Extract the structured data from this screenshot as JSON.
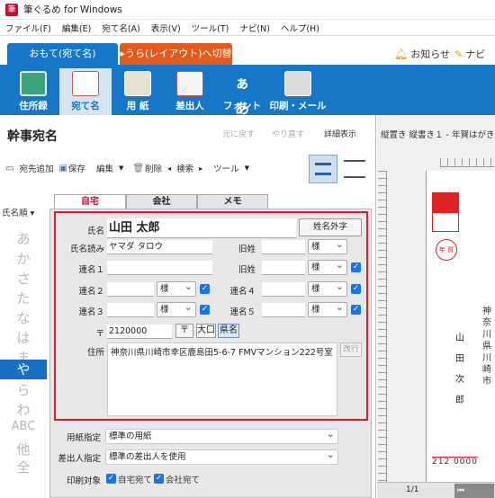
{
  "titlebar": {
    "title": "筆ぐるめ for Windows"
  },
  "menu": [
    "ファイル(F)",
    "編集(E)",
    "宛て名(A)",
    "表示(V)",
    "ツール(T)",
    "ナビ(N)",
    "ヘルプ(H)"
  ],
  "tabs": {
    "omote": "おもて(宛て名)",
    "ura": "▸うら(レイアウト)へ切替",
    "oshirase": "お知らせ",
    "navi": "ナビ"
  },
  "ribbon": [
    "住所録",
    "宛て名",
    "用 紙",
    "差出人",
    "フォント",
    "印刷・メール"
  ],
  "panel": {
    "title": "幹事宛名",
    "undo": "元に戻す",
    "redo": "やり直す",
    "detail": "詳細表示"
  },
  "toolbar": {
    "add": "宛先追加",
    "save": "保存",
    "edit": "編集",
    "delete": "削除",
    "search": "検索",
    "tools": "ツール"
  },
  "sort": "氏名順",
  "index": [
    "あ",
    "か",
    "さ",
    "た",
    "な",
    "は",
    "ま",
    "や",
    "ら",
    "わ",
    "ABC",
    "他",
    "全"
  ],
  "subtabs": [
    "自宅",
    "会社",
    "メモ"
  ],
  "form": {
    "name_label": "氏名",
    "name_value": "山田 太郎",
    "ext_char_button": "姓名外字",
    "kana_label": "氏名読み",
    "kana_value": "ヤマダ タロウ",
    "kyusei_label": "旧姓",
    "honorific": "様",
    "ren1": "連名１",
    "ren2": "連名２",
    "ren3": "連名３",
    "ren4": "連名４",
    "ren5": "連名５",
    "zip_mark": "〒",
    "zip_value": "2120000",
    "zip_btn": "〒",
    "ooguchi": "大口",
    "kenmei": "県名",
    "addr_label": "住所",
    "addr_value": "神奈川県川崎市幸区鹿島田5-6-7  FMVマンション222号室",
    "kaigyo": "改行"
  },
  "bottom": {
    "paper_label": "用紙指定",
    "paper_value": "標準の用紙",
    "sender_label": "差出人指定",
    "sender_value": "標準の差出人を使用",
    "print_label": "印刷対象",
    "home_target": "自宅宛て",
    "office_target": "会社宛て"
  },
  "preview": {
    "header": "縦置き 縦書き１ - 年賀はがき",
    "page": "1/1",
    "zip": "212 0000",
    "name_chars": [
      "山",
      "田",
      "次",
      "郎"
    ],
    "stamp": "年 賀"
  }
}
